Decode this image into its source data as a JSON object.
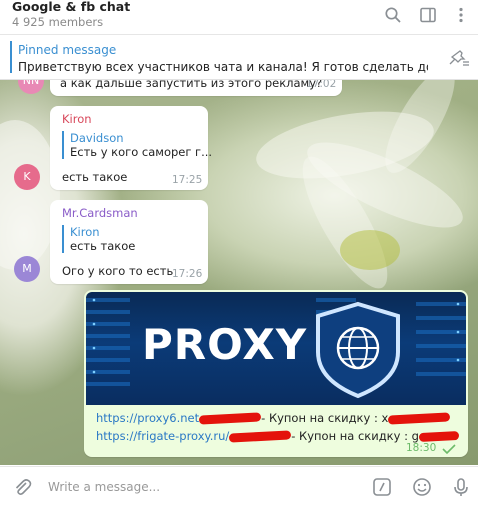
{
  "header": {
    "title": "Google & fb chat",
    "members": "4 925 members"
  },
  "pinned": {
    "title": "Pinned message",
    "text": "Приветствую всех участников чата и канала! Я готов сделать довольно ..."
  },
  "messages": {
    "m0": {
      "text": "а как дальше запустить из этого рекламу?",
      "time": "17:02",
      "avatar": "NN",
      "avatar_color": "#e889b5"
    },
    "m1": {
      "sender": "Kiron",
      "sender_color": "#d8485b",
      "reply_name": "Davidson",
      "reply_text": "Есть у кого саморег г...",
      "text": "есть такое",
      "time": "17:25",
      "avatar": "K",
      "avatar_color": "#e66b8c"
    },
    "m2": {
      "sender": "Mr.Cardsman",
      "sender_color": "#8a5cc8",
      "reply_name": "Kiron",
      "reply_text": "есть такое",
      "text": "Ого у кого то есть",
      "time": "17:26",
      "avatar": "M",
      "avatar_color": "#9b87d6"
    },
    "m3": {
      "banner_text": "PROXY",
      "line1_link": "https://proxy6.net",
      "line1_text": "- Купон на скидку : x",
      "line2_link": "https://frigate-proxy.ru/",
      "line2_text": "- Купон на скидку : g",
      "time": "18:30"
    }
  },
  "composer": {
    "placeholder": "Write a message..."
  },
  "colors": {
    "accent": "#3a8fd1",
    "outgoing": "#eefdde"
  }
}
